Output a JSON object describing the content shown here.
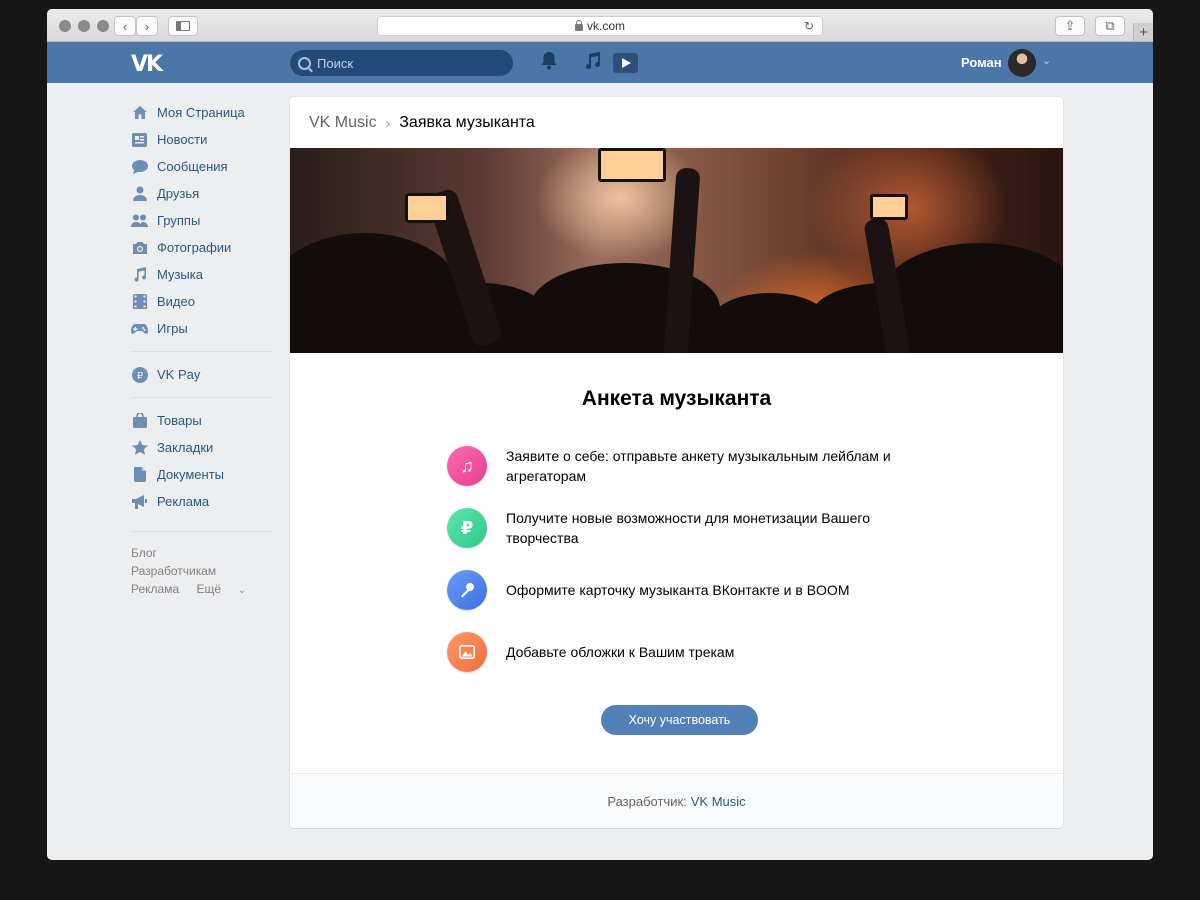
{
  "browser": {
    "url": "vk.com",
    "new_tab": "+"
  },
  "header": {
    "logo": "VK",
    "search_placeholder": "Поиск",
    "user_name": "Роман"
  },
  "sidebar": {
    "items": [
      {
        "label": "Моя Страница",
        "icon": "home-icon"
      },
      {
        "label": "Новости",
        "icon": "news-icon"
      },
      {
        "label": "Сообщения",
        "icon": "messages-icon"
      },
      {
        "label": "Друзья",
        "icon": "friends-icon"
      },
      {
        "label": "Группы",
        "icon": "groups-icon"
      },
      {
        "label": "Фотографии",
        "icon": "camera-icon"
      },
      {
        "label": "Музыка",
        "icon": "music-note-icon"
      },
      {
        "label": "Видео",
        "icon": "film-icon"
      },
      {
        "label": "Игры",
        "icon": "gamepad-icon"
      }
    ],
    "vkpay": {
      "label": "VK Pay",
      "icon": "ruble-circle-icon"
    },
    "more_items": [
      {
        "label": "Товары",
        "icon": "shopping-bag-icon"
      },
      {
        "label": "Закладки",
        "icon": "star-icon"
      },
      {
        "label": "Документы",
        "icon": "document-icon"
      },
      {
        "label": "Реклама",
        "icon": "megaphone-icon"
      }
    ],
    "footer": {
      "blog": "Блог",
      "developers": "Разработчикам",
      "ads": "Реклама",
      "more": "Ещё"
    }
  },
  "card": {
    "breadcrumb_root": "VK Music",
    "breadcrumb_current": "Заявка музыканта",
    "title": "Анкета музыканта",
    "features": [
      {
        "text": "Заявите о себе: отправьте анкету музыкальным лейблам и агрегаторам",
        "icon": "music-note-icon",
        "color": "#f0509c",
        "glyph": "♫"
      },
      {
        "text": "Получите новые возможности для монетизации Вашего творчества",
        "icon": "ruble-icon",
        "color": "#45d69b",
        "glyph": "₽"
      },
      {
        "text": "Оформите карточку музыканта ВКонтакте и в BOOM",
        "icon": "microphone-icon",
        "color": "#4f86ee",
        "glyph": "🎤"
      },
      {
        "text": "Добавьте обложки к Вашим трекам",
        "icon": "image-icon",
        "color": "#f7804f",
        "glyph": "▣"
      }
    ],
    "cta": "Хочу участвовать",
    "footer_label": "Разработчик:",
    "footer_link": "VK Music"
  }
}
